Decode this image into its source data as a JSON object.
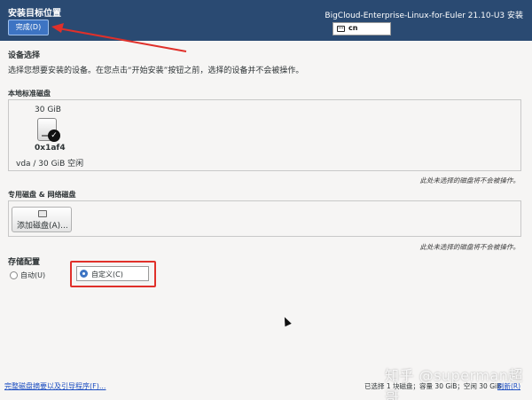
{
  "header": {
    "title": "安装目标位置",
    "done_button": "完成(D)",
    "product": "BigCloud-Enterprise-Linux-for-Euler 21.10-U3 安装",
    "keyboard_layout": "cn"
  },
  "device_selection": {
    "title": "设备选择",
    "description": "选择您想要安装的设备。在您点击“开始安装”按钮之前，选择的设备并不会被操作。"
  },
  "local_disks": {
    "title": "本地标准磁盘",
    "disk": {
      "size": "30 GiB",
      "name": "0x1af4",
      "info": "vda / 30 GiB 空闲"
    },
    "note": "此处未选择的磁盘将不会被操作。"
  },
  "specialized_disks": {
    "title": "专用磁盘 & 网络磁盘",
    "add_button": "添加磁盘(A)...",
    "note": "此处未选择的磁盘将不会被操作。"
  },
  "storage_config": {
    "title": "存储配置",
    "options": [
      {
        "label": "自动(U)",
        "selected": false
      },
      {
        "label": "自定义(C)",
        "selected": true
      }
    ]
  },
  "footer": {
    "summary_link": "完整磁盘摘要以及引导程序(F)...",
    "status": "已选择 1 块磁盘；容量 30 GiB；空闲 30 GiB",
    "refresh": "刷新(R)"
  },
  "watermark": "知乎 @superman超哥",
  "colors": {
    "header_bg": "#2a4a72",
    "accent": "#3d74c3",
    "annotation": "#e0302a"
  }
}
